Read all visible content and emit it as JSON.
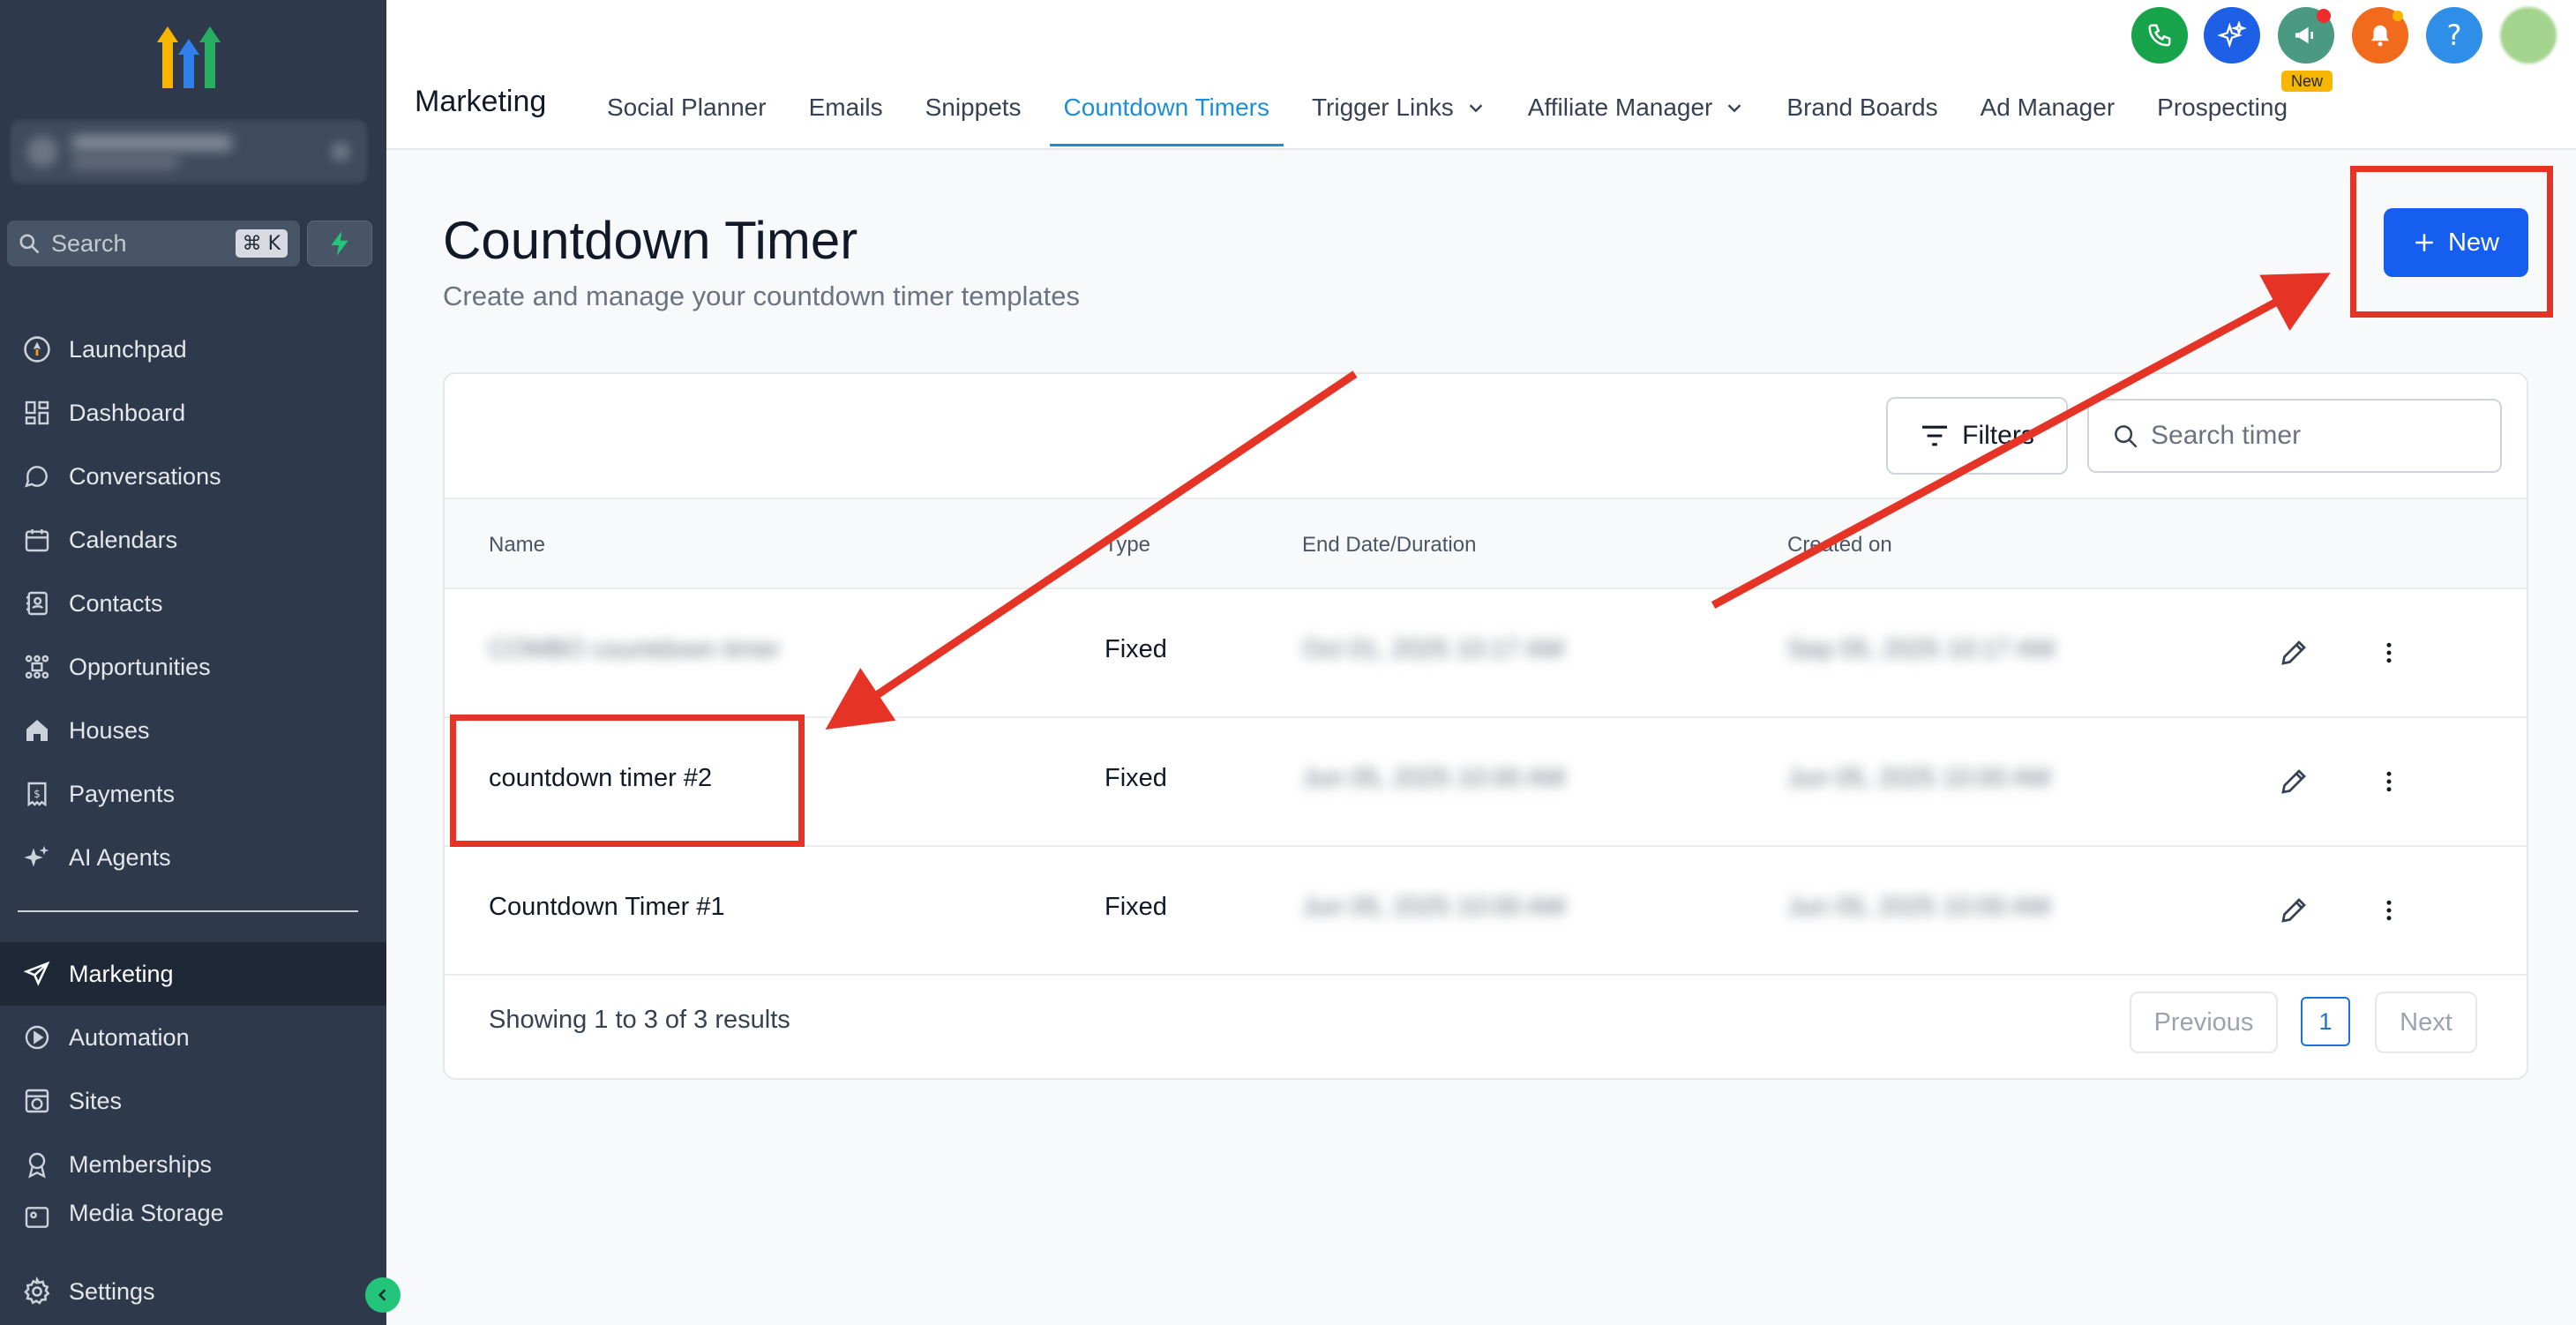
{
  "sidebar": {
    "search_label": "Search",
    "search_shortcut": "⌘ K",
    "items": [
      {
        "label": "Launchpad"
      },
      {
        "label": "Dashboard"
      },
      {
        "label": "Conversations"
      },
      {
        "label": "Calendars"
      },
      {
        "label": "Contacts"
      },
      {
        "label": "Opportunities"
      },
      {
        "label": "Houses"
      },
      {
        "label": "Payments"
      },
      {
        "label": "AI Agents"
      }
    ],
    "items2": [
      {
        "label": "Marketing"
      },
      {
        "label": "Automation"
      },
      {
        "label": "Sites"
      },
      {
        "label": "Memberships"
      },
      {
        "label": "Media Storage"
      }
    ],
    "settings_label": "Settings"
  },
  "header": {
    "section_title": "Marketing",
    "tabs": [
      {
        "label": "Social Planner"
      },
      {
        "label": "Emails"
      },
      {
        "label": "Snippets"
      },
      {
        "label": "Countdown Timers"
      },
      {
        "label": "Trigger Links"
      },
      {
        "label": "Affiliate Manager"
      },
      {
        "label": "Brand Boards"
      },
      {
        "label": "Ad Manager"
      },
      {
        "label": "Prospecting"
      }
    ],
    "new_badge": "New"
  },
  "page": {
    "title": "Countdown Timer",
    "subtitle": "Create and manage your countdown timer templates",
    "new_button": "New"
  },
  "toolbar": {
    "filters_label": "Filters",
    "search_placeholder": "Search timer"
  },
  "table": {
    "columns": [
      "Name",
      "Type",
      "End Date/Duration",
      "Created on"
    ],
    "rows": [
      {
        "name": "COMBO countdown timer",
        "type": "Fixed",
        "end": "Oct 01, 2025 10:17 AM",
        "created": "Sep 05, 2025 10:17 AM",
        "blurred": true
      },
      {
        "name": "countdown timer #2",
        "type": "Fixed",
        "end": "Jun 05, 2025 10:00 AM",
        "created": "Jun 05, 2025 10:00 AM",
        "blurred": false
      },
      {
        "name": "Countdown Timer #1",
        "type": "Fixed",
        "end": "Jun 05, 2025 10:00 AM",
        "created": "Jun 05, 2025 10:00 AM",
        "blurred": false
      }
    ]
  },
  "pagination": {
    "summary": "Showing 1 to 3 of 3 results",
    "previous": "Previous",
    "current_page": "1",
    "next": "Next"
  },
  "colors": {
    "sidebar_bg": "#2e3a4b",
    "accent_blue": "#155eef",
    "active_tab": "#1d8fd8",
    "annotation_red": "#e53326"
  }
}
